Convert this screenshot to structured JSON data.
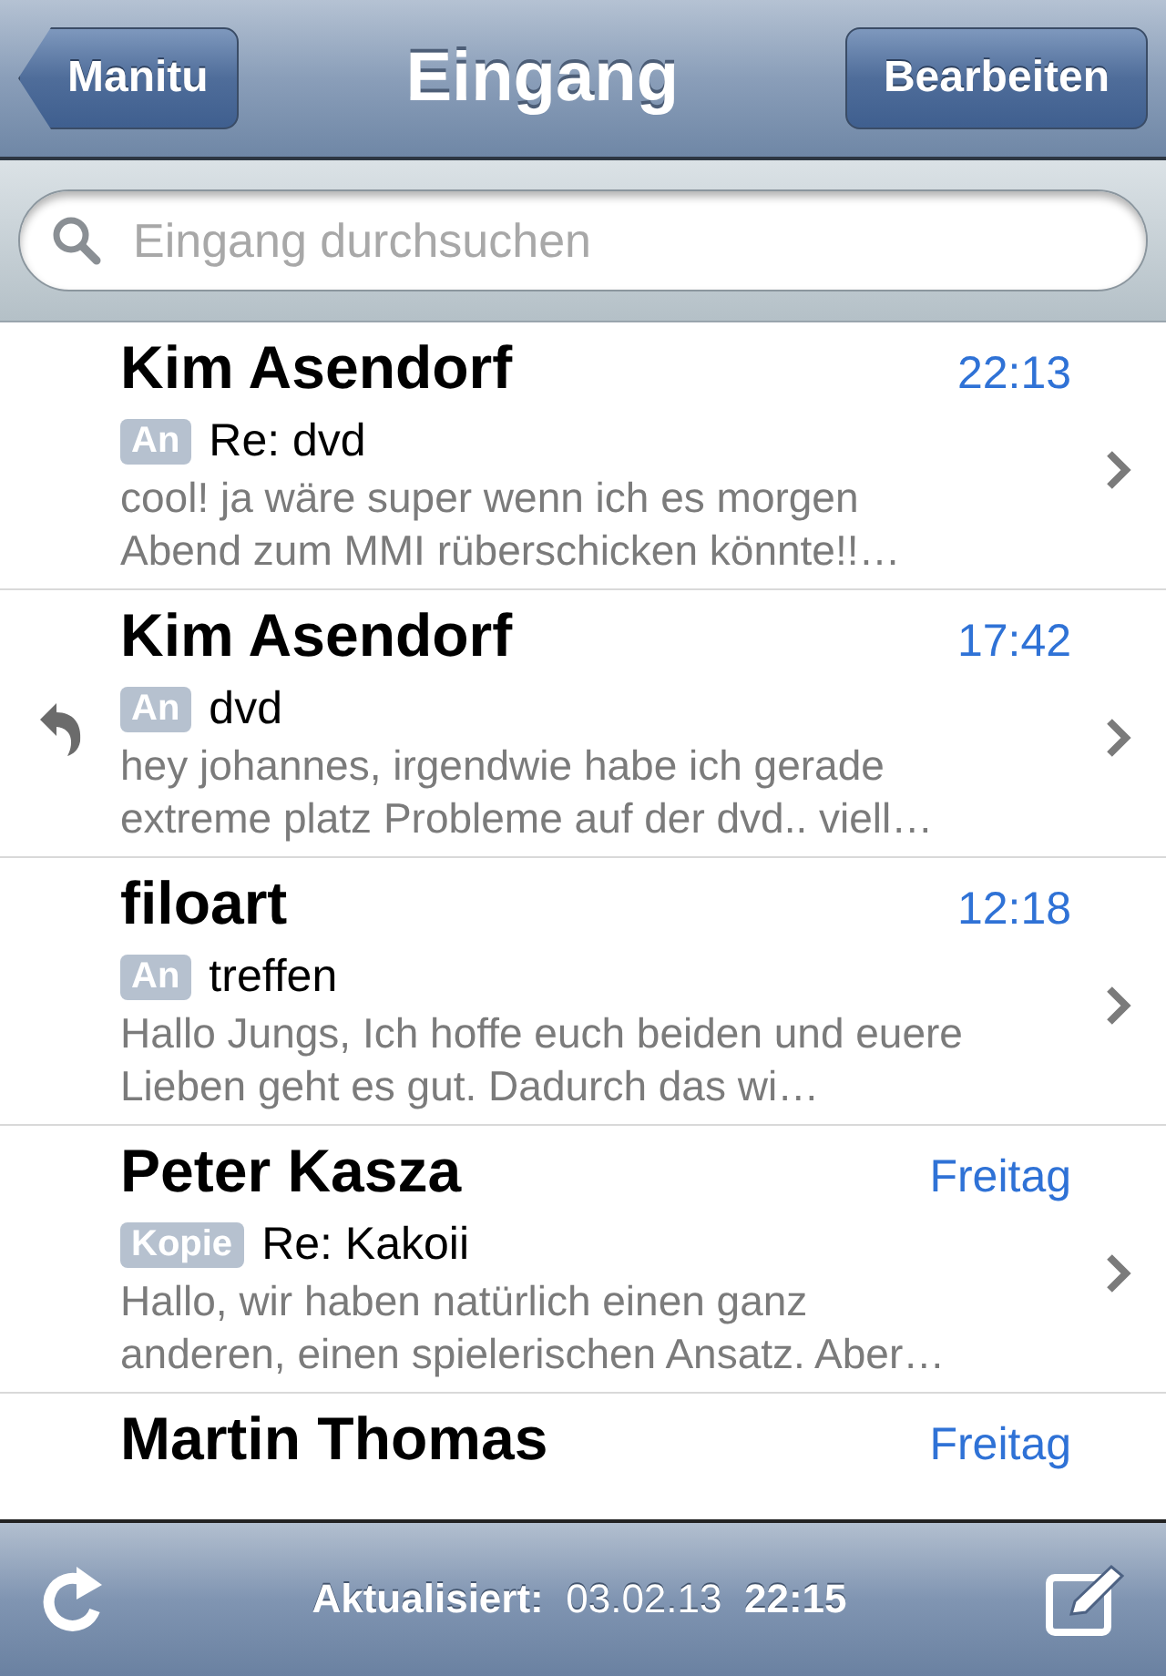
{
  "nav_bar": {
    "back_button": "Manitu",
    "title": "Eingang",
    "edit_button": "Bearbeiten"
  },
  "search": {
    "placeholder": "Eingang durchsuchen"
  },
  "messages": [
    {
      "sender": "Kim Asendorf",
      "time": "22:13",
      "recipient_badge": "An",
      "subject": "Re: dvd",
      "preview": "cool! ja wäre super wenn ich es morgen Abend zum MMI rüberschicken könnte!!…",
      "replied": false
    },
    {
      "sender": "Kim Asendorf",
      "time": "17:42",
      "recipient_badge": "An",
      "subject": "dvd",
      "preview": "hey johannes, irgendwie habe ich gerade extreme platz Probleme auf der dvd.. viell…",
      "replied": true
    },
    {
      "sender": "filoart",
      "time": "12:18",
      "recipient_badge": "An",
      "subject": "treffen",
      "preview": "Hallo Jungs, Ich hoffe euch beiden und euere Lieben geht es gut. Dadurch das wi…",
      "replied": false
    },
    {
      "sender": "Peter Kasza",
      "time": "Freitag",
      "recipient_badge": "Kopie",
      "subject": "Re: Kakoii",
      "preview": "Hallo, wir haben natürlich einen ganz anderen, einen spielerischen Ansatz. Aber…",
      "replied": false
    },
    {
      "sender": "Martin Thomas",
      "time": "Freitag"
    }
  ],
  "toolbar": {
    "status": "**Aktualisiert:**  03.02.13  **22:15**"
  }
}
